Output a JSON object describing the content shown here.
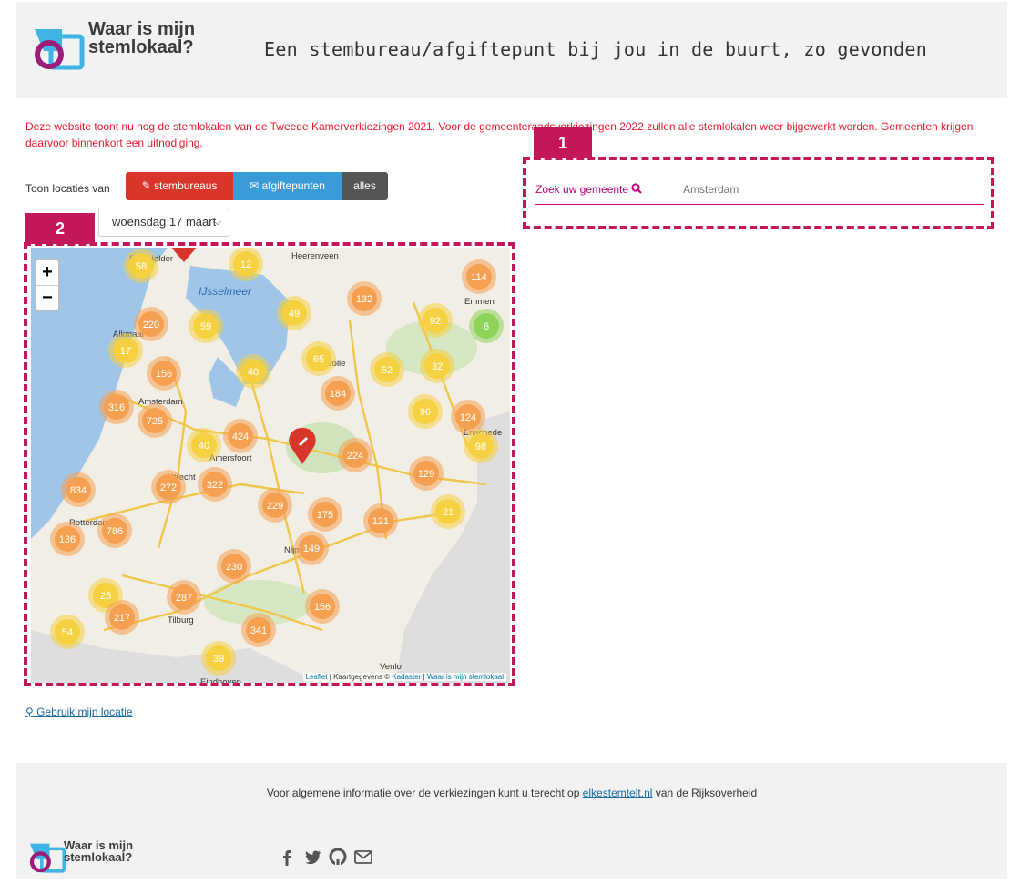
{
  "header": {
    "brand": [
      "Waar is mijn",
      "stemlokaal?"
    ],
    "tagline": "Een stembureau/afgiftepunt bij jou in de buurt, zo gevonden"
  },
  "notice": "Deze website toont nu nog de stemlokalen van de Tweede Kamerverkiezingen 2021. Voor de gemeenteraadsverkiezingen 2022 zullen alle stemlokalen weer bijgewerkt worden. Gemeenten krijgen daarvoor binnenkort een uitnodiging.",
  "filters": {
    "label": "Toon locaties van",
    "stembureaus": "stembureaus",
    "afgiftepunten": "afgiftepunten",
    "alles": "alles",
    "date_selected": "woensdag 17 maart"
  },
  "search": {
    "label": "Zoek uw gemeente",
    "placeholder": "Amsterdam"
  },
  "annotations": [
    "1",
    "2"
  ],
  "map": {
    "zoom_in": "+",
    "zoom_out": "−",
    "attribution": {
      "leaflet": "Leaflet",
      "kaart": "Kaartgegevens ©",
      "kadaster": "Kadaster",
      "sep": "|",
      "wims": "Waar is mijn stemlokaal"
    },
    "water_label": "IJsselmeer",
    "place_labels": [
      "Emmen",
      "Zwolle",
      "Amsterdam",
      "Amersfoort",
      "Utrecht",
      "Rotterdam",
      "Tilburg",
      "Eindhoven",
      "Venlo",
      "Enschede",
      "Nijmegen",
      "Alkmaar",
      "Den Helder",
      "Heerenveen"
    ],
    "clusters": [
      {
        "n": "58",
        "color": "yellow"
      },
      {
        "n": "12",
        "color": "yellow"
      },
      {
        "n": "114",
        "color": "orange"
      },
      {
        "n": "132",
        "color": "orange"
      },
      {
        "n": "49",
        "color": "yellow"
      },
      {
        "n": "220",
        "color": "orange"
      },
      {
        "n": "59",
        "color": "yellow"
      },
      {
        "n": "92",
        "color": "yellow"
      },
      {
        "n": "6",
        "color": "green"
      },
      {
        "n": "17",
        "color": "yellow"
      },
      {
        "n": "65",
        "color": "yellow"
      },
      {
        "n": "156",
        "color": "orange"
      },
      {
        "n": "40",
        "color": "yellow"
      },
      {
        "n": "52",
        "color": "yellow"
      },
      {
        "n": "32",
        "color": "yellow"
      },
      {
        "n": "184",
        "color": "orange"
      },
      {
        "n": "316",
        "color": "orange"
      },
      {
        "n": "725",
        "color": "orange"
      },
      {
        "n": "96",
        "color": "yellow"
      },
      {
        "n": "124",
        "color": "orange"
      },
      {
        "n": "424",
        "color": "orange"
      },
      {
        "n": "40",
        "color": "yellow"
      },
      {
        "n": "224",
        "color": "orange"
      },
      {
        "n": "98",
        "color": "yellow"
      },
      {
        "n": "129",
        "color": "orange"
      },
      {
        "n": "834",
        "color": "orange"
      },
      {
        "n": "272",
        "color": "orange"
      },
      {
        "n": "322",
        "color": "orange"
      },
      {
        "n": "229",
        "color": "orange"
      },
      {
        "n": "175",
        "color": "orange"
      },
      {
        "n": "121",
        "color": "orange"
      },
      {
        "n": "21",
        "color": "yellow"
      },
      {
        "n": "786",
        "color": "orange"
      },
      {
        "n": "136",
        "color": "orange"
      },
      {
        "n": "149",
        "color": "orange"
      },
      {
        "n": "230",
        "color": "orange"
      },
      {
        "n": "25",
        "color": "yellow"
      },
      {
        "n": "287",
        "color": "orange"
      },
      {
        "n": "217",
        "color": "orange"
      },
      {
        "n": "156",
        "color": "orange"
      },
      {
        "n": "54",
        "color": "yellow"
      },
      {
        "n": "341",
        "color": "orange"
      },
      {
        "n": "39",
        "color": "yellow"
      }
    ]
  },
  "geolocate": "Gebruik mijn locatie",
  "footer": {
    "info_pre": "Voor algemene informatie over de verkiezingen kunt u terecht op",
    "info_link": "elkestemtelt.nl",
    "info_post": "van de Rijksoverheid",
    "brand": [
      "Waar is mijn",
      "stemlokaal?"
    ]
  },
  "colors": {
    "accent": "#c4175a",
    "notice": "#e8182c",
    "btn_red": "#d9362b",
    "btn_blue": "#3a9bd9",
    "btn_grey": "#555555",
    "cluster_orange": "#f5a050",
    "cluster_yellow": "#f5d040",
    "cluster_green": "#8fd45a"
  }
}
